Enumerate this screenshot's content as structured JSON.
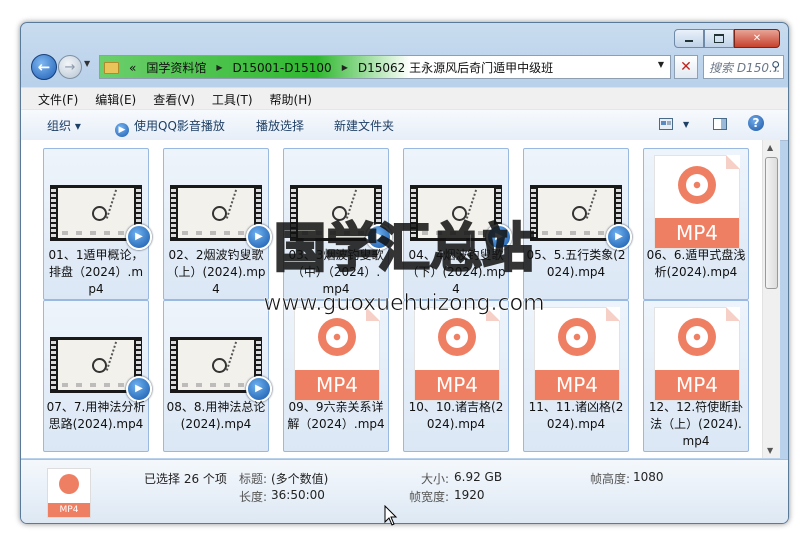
{
  "window": {
    "caption_buttons": {
      "minimize": "▭",
      "maximize": "▭",
      "close": "✕"
    }
  },
  "nav": {
    "back_icon": "arrow-left-icon",
    "forward_icon": "arrow-right-icon",
    "breadcrumb_lead": "«",
    "breadcrumbs": [
      "国学资料馆",
      "D15001-D15100",
      "D15062 王永源风后奇门遁甲中级班"
    ],
    "search_placeholder": "搜索 D150...",
    "refresh": "✕"
  },
  "menu": [
    "文件(F)",
    "编辑(E)",
    "查看(V)",
    "工具(T)",
    "帮助(H)"
  ],
  "toolbar": {
    "organize": "组织 ▾",
    "play_qq": "使用QQ影音播放",
    "play_selection": "播放选择",
    "new_folder": "新建文件夹"
  },
  "files": [
    {
      "name": "01、1遁甲概论，排盘（2024）.mp4",
      "kind": "video"
    },
    {
      "name": "02、2烟波钓叟歌（上）(2024).mp4",
      "kind": "video"
    },
    {
      "name": "03、3烟波钓叟歌（中）（2024）.mp4",
      "kind": "video"
    },
    {
      "name": "04、4烟波钓叟歌（下）(2024).mp4",
      "kind": "video"
    },
    {
      "name": "05、5.五行类象(2024).mp4",
      "kind": "video"
    },
    {
      "name": "06、6.遁甲式盘浅析(2024).mp4",
      "kind": "doc"
    },
    {
      "name": "07、7.用神法分析思路(2024).mp4",
      "kind": "video"
    },
    {
      "name": "08、8.用神法总论(2024).mp4",
      "kind": "video"
    },
    {
      "name": "09、9六亲关系详解（2024）.mp4",
      "kind": "doc"
    },
    {
      "name": "10、10.诸吉格(2024).mp4",
      "kind": "doc"
    },
    {
      "name": "11、11.诸凶格(2024).mp4",
      "kind": "doc"
    },
    {
      "name": "12、12.符使断卦法（上）(2024).mp4",
      "kind": "doc"
    }
  ],
  "mp4_label": "MP4",
  "details": {
    "selected": "已选择 26 个项",
    "title_label": "标题:",
    "title_value": "(多个数值)",
    "length_label": "长度:",
    "length_value": "36:50:00",
    "size_label": "大小:",
    "size_value": "6.92 GB",
    "fwidth_label": "帧宽度:",
    "fwidth_value": "1920",
    "fheight_label": "帧高度:",
    "fheight_value": "1080",
    "icon_label": "MP4"
  },
  "watermark": {
    "title": "国学汇总站",
    "url": "www.guoxuehuizong.com"
  }
}
